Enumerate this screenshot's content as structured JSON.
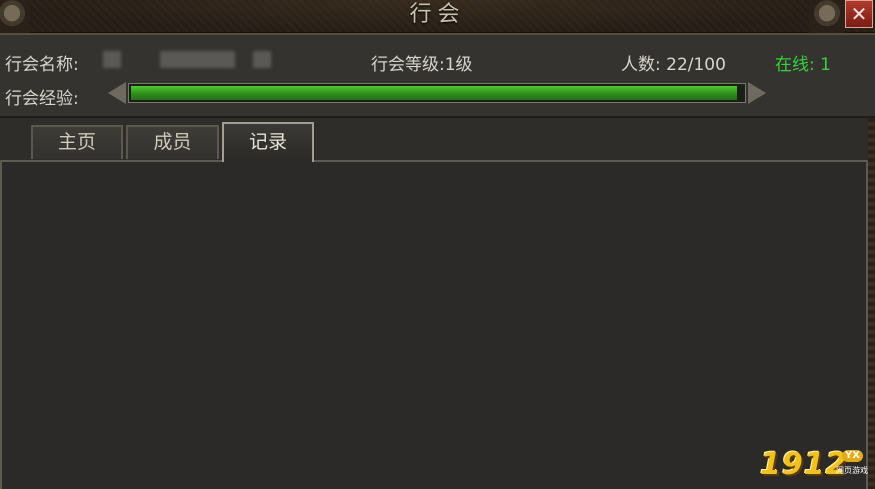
{
  "window": {
    "title": "行会",
    "close_label": "✕"
  },
  "info": {
    "name_label": "行会名称:",
    "level_label": "行会等级:1级",
    "members_label": "人数:  22/100",
    "online_label": "在线: 1",
    "exp_label": "行会经验:",
    "exp_fraction": 0.99,
    "exp_color": "#3ca826"
  },
  "tabs": [
    {
      "label": "主页",
      "active": false
    },
    {
      "label": "成员",
      "active": false
    },
    {
      "label": "记录",
      "active": true
    }
  ],
  "watermark": {
    "digits": "1912",
    "badge": "YX",
    "site": "网页游戏"
  }
}
